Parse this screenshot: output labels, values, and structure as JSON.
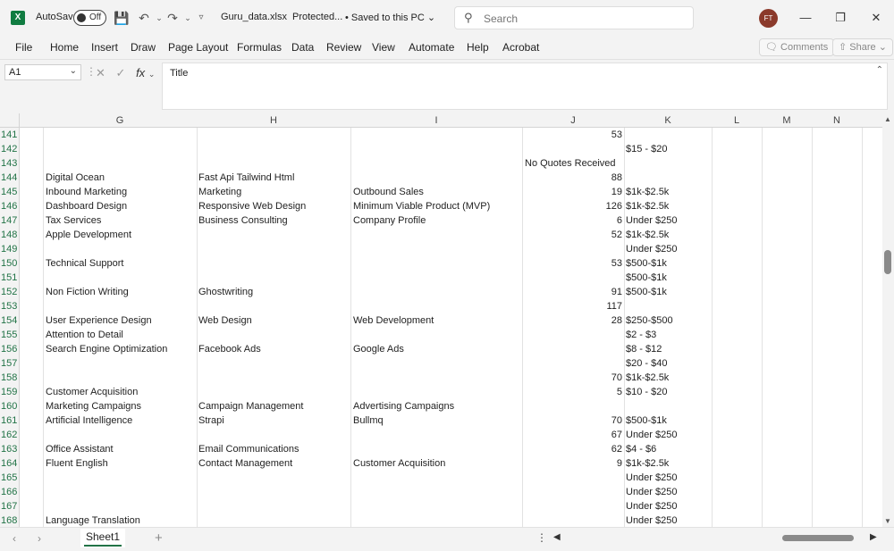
{
  "titlebar": {
    "app_icon": "excel-logo",
    "app_icon_letter": "X",
    "autosave_label": "AutoSave",
    "autosave_state": "Off",
    "filename": "Guru_data.xlsx",
    "protected": "Protected...",
    "saved": "• Saved to this PC",
    "search_placeholder": "Search",
    "user_initials": "FT"
  },
  "ribbon": {
    "tabs": [
      "File",
      "Home",
      "Insert",
      "Draw",
      "Page Layout",
      "Formulas",
      "Data",
      "Review",
      "View",
      "Automate",
      "Help",
      "Acrobat"
    ],
    "comments_label": "Comments",
    "share_label": "Share"
  },
  "formula_bar": {
    "name_box": "A1",
    "fx_label": "fx",
    "formula_text": "Title"
  },
  "grid": {
    "columns": [
      "G",
      "H",
      "I",
      "J",
      "K",
      "L",
      "M",
      "N"
    ],
    "rows": [
      {
        "n": "141",
        "G": "",
        "H": "",
        "I": "",
        "J": "53",
        "K": ""
      },
      {
        "n": "142",
        "G": "",
        "H": "",
        "I": "",
        "J": "",
        "K": "$15 - $20"
      },
      {
        "n": "143",
        "G": "",
        "H": "",
        "I": "",
        "J": "No Quotes Received",
        "K": ""
      },
      {
        "n": "144",
        "G": "Digital Ocean",
        "H": "Fast Api Tailwind Html",
        "I": "",
        "J": "88",
        "K": ""
      },
      {
        "n": "145",
        "G": "Inbound Marketing",
        "H": "Marketing",
        "I": "Outbound Sales",
        "J": "19",
        "K": "$1k-$2.5k"
      },
      {
        "n": "146",
        "G": "Dashboard Design",
        "H": "Responsive Web Design",
        "I": "Minimum Viable Product (MVP)",
        "J": "126",
        "K": "$1k-$2.5k"
      },
      {
        "n": "147",
        "G": "Tax Services",
        "H": "Business Consulting",
        "I": "Company Profile",
        "J": "6",
        "K": "Under $250"
      },
      {
        "n": "148",
        "G": "Apple Development",
        "H": "",
        "I": "",
        "J": "52",
        "K": "$1k-$2.5k"
      },
      {
        "n": "149",
        "G": "",
        "H": "",
        "I": "",
        "J": "",
        "K": "Under $250"
      },
      {
        "n": "150",
        "G": "Technical Support",
        "H": "",
        "I": "",
        "J": "53",
        "K": "$500-$1k"
      },
      {
        "n": "151",
        "G": "",
        "H": "",
        "I": "",
        "J": "",
        "K": "$500-$1k"
      },
      {
        "n": "152",
        "G": "Non Fiction Writing",
        "H": "Ghostwriting",
        "I": "",
        "J": "91",
        "K": "$500-$1k"
      },
      {
        "n": "153",
        "G": "",
        "H": "",
        "I": "",
        "J": "117",
        "K": ""
      },
      {
        "n": "154",
        "G": "User Experience Design",
        "H": "Web Design",
        "I": "Web Development",
        "J": "28",
        "K": "$250-$500"
      },
      {
        "n": "155",
        "G": "Attention to Detail",
        "H": "",
        "I": "",
        "J": "",
        "K": "$2 - $3"
      },
      {
        "n": "156",
        "G": "Search Engine Optimization",
        "H": "Facebook Ads",
        "I": "Google Ads",
        "J": "",
        "K": "$8 - $12"
      },
      {
        "n": "157",
        "G": "",
        "H": "",
        "I": "",
        "J": "",
        "K": "$20 - $40"
      },
      {
        "n": "158",
        "G": "",
        "H": "",
        "I": "",
        "J": "70",
        "K": "$1k-$2.5k"
      },
      {
        "n": "159",
        "G": "Customer Acquisition",
        "H": "",
        "I": "",
        "J": "5",
        "K": "$10 - $20"
      },
      {
        "n": "160",
        "G": "Marketing Campaigns",
        "H": "Campaign Management",
        "I": "Advertising Campaigns",
        "J": "",
        "K": ""
      },
      {
        "n": "161",
        "G": "Artificial Intelligence",
        "H": "Strapi",
        "I": "Bullmq",
        "J": "70",
        "K": "$500-$1k"
      },
      {
        "n": "162",
        "G": "",
        "H": "",
        "I": "",
        "J": "67",
        "K": "Under $250"
      },
      {
        "n": "163",
        "G": "Office Assistant",
        "H": "Email Communications",
        "I": "",
        "J": "62",
        "K": "$4 - $6"
      },
      {
        "n": "164",
        "G": "Fluent English",
        "H": "Contact Management",
        "I": "Customer Acquisition",
        "J": "9",
        "K": "$1k-$2.5k"
      },
      {
        "n": "165",
        "G": "",
        "H": "",
        "I": "",
        "J": "",
        "K": "Under $250"
      },
      {
        "n": "166",
        "G": "",
        "H": "",
        "I": "",
        "J": "",
        "K": "Under $250"
      },
      {
        "n": "167",
        "G": "",
        "H": "",
        "I": "",
        "J": "",
        "K": "Under $250"
      },
      {
        "n": "168",
        "G": "Language Translation",
        "H": "",
        "I": "",
        "J": "",
        "K": "Under $250"
      }
    ]
  },
  "sheets": {
    "active": "Sheet1",
    "add_label": "+"
  },
  "colors": {
    "accent": "#217346",
    "excel_green": "#107c41"
  }
}
